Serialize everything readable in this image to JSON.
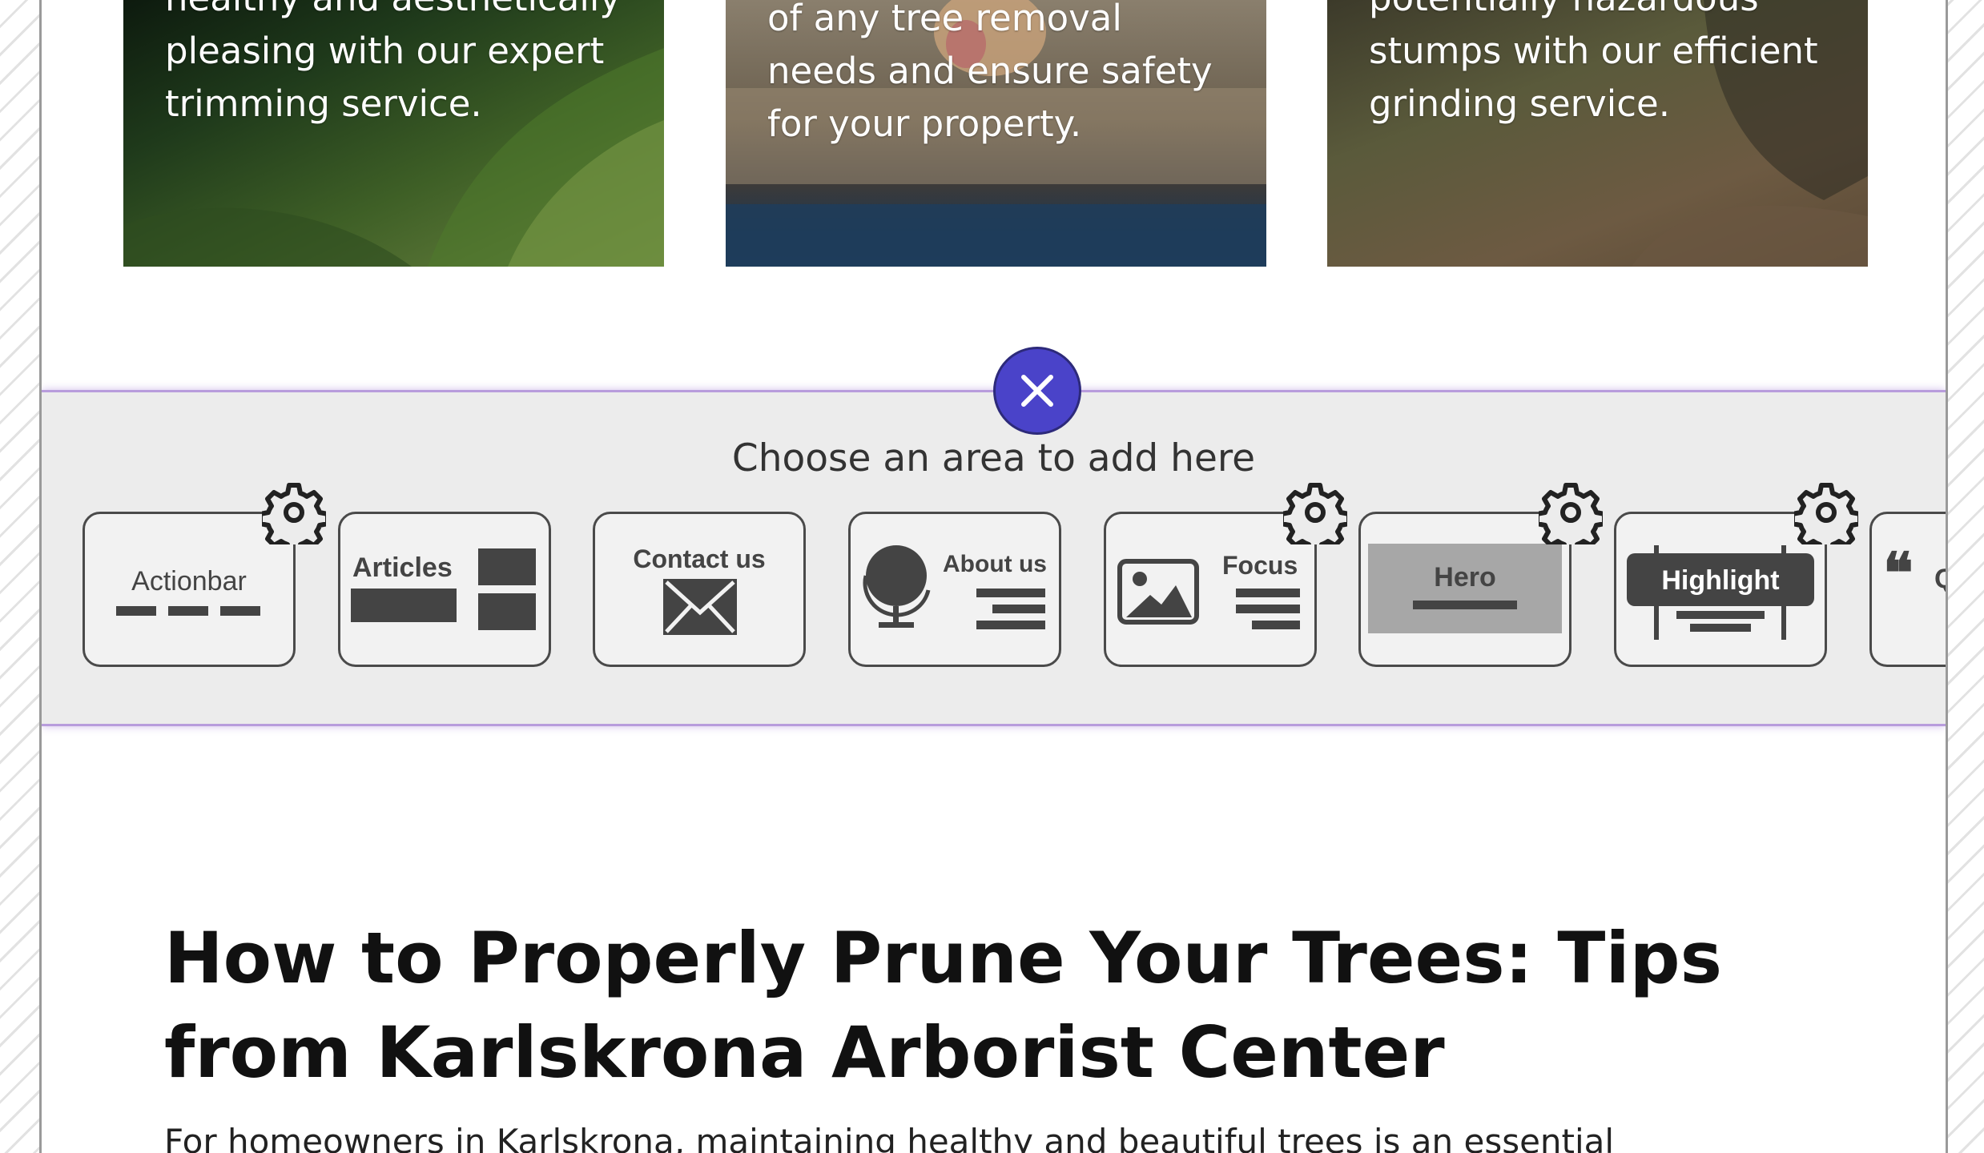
{
  "service_cards": [
    {
      "text": "healthy and aesthetically pleasing with our expert trimming service."
    },
    {
      "text": "of any tree removal needs and ensure safety for your property."
    },
    {
      "text": "potentially hazardous stumps with our efficient grinding service."
    }
  ],
  "area_picker": {
    "close_icon": "close-icon",
    "title": "Choose an area to add here",
    "tiles": [
      {
        "label": "Actionbar",
        "has_settings": true
      },
      {
        "label": "Articles",
        "has_settings": false
      },
      {
        "label": "Contact us",
        "has_settings": false
      },
      {
        "label": "About us",
        "has_settings": false
      },
      {
        "label": "Focus",
        "has_settings": true
      },
      {
        "label": "Hero",
        "has_settings": true
      },
      {
        "label": "Highlight",
        "has_settings": true
      },
      {
        "label": "Q",
        "has_settings": false
      }
    ],
    "settings_icon": "gear-icon"
  },
  "article": {
    "title": "How to Properly Prune Your Trees: Tips from Karlskrona Arborist Center",
    "intro": "For homeowners in Karlskrona, maintaining healthy and beautiful trees is an essential"
  },
  "colors": {
    "accent": "#4a43c9",
    "picker_border": "#b89cdc",
    "picker_bg": "#ececec"
  }
}
